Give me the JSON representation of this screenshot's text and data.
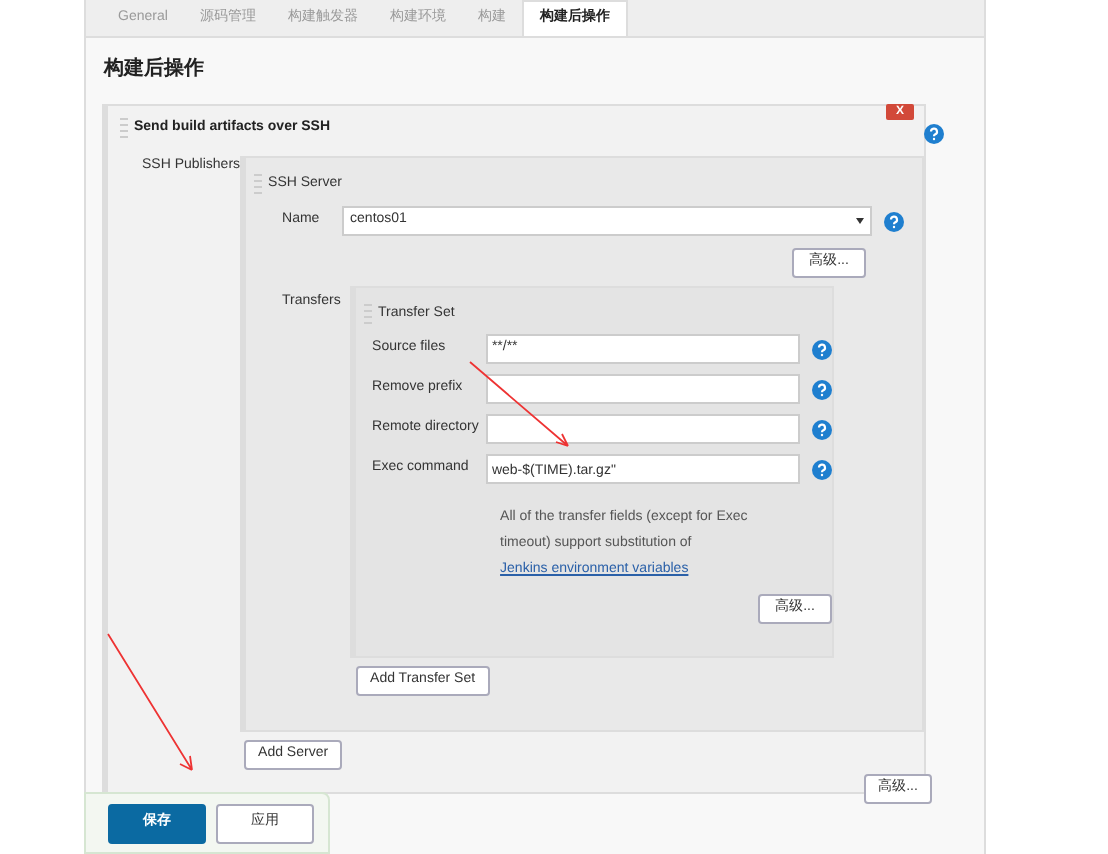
{
  "tabs": [
    {
      "label": "General",
      "selected": false
    },
    {
      "label": "源码管理",
      "selected": false
    },
    {
      "label": "构建触发器",
      "selected": false
    },
    {
      "label": "构建环境",
      "selected": false
    },
    {
      "label": "构建",
      "selected": false
    },
    {
      "label": "构建后操作",
      "selected": true
    }
  ],
  "section_title": "构建后操作",
  "publisher": {
    "title": "Send build artifacts over SSH",
    "delete": "X",
    "label": "SSH Publishers",
    "server": {
      "title": "SSH Server",
      "name_label": "Name",
      "name_value": "centos01",
      "advanced": "高级...",
      "transfers_label": "Transfers",
      "transfer_set": {
        "title": "Transfer Set",
        "fields": [
          {
            "label": "Source files",
            "value": "**/**",
            "kind": "input"
          },
          {
            "label": "Remove prefix",
            "kind": "input"
          },
          {
            "label": "Remote directory",
            "kind": "input"
          },
          {
            "label": "Exec command",
            "value": "web-$(TIME).tar.gz\"",
            "kind": "textarea"
          }
        ],
        "note": "All of the transfer fields (except for Exec timeout) support substitution of ",
        "note_link": "Jenkins environment variables",
        "advanced": "高级..."
      },
      "add_transfer_set": "Add Transfer Set"
    },
    "add_server": "Add Server",
    "advanced": "高级..."
  },
  "buttons": [
    {
      "label": "保存",
      "kind": "primary"
    },
    {
      "label": "应用",
      "kind": "secondary"
    }
  ]
}
